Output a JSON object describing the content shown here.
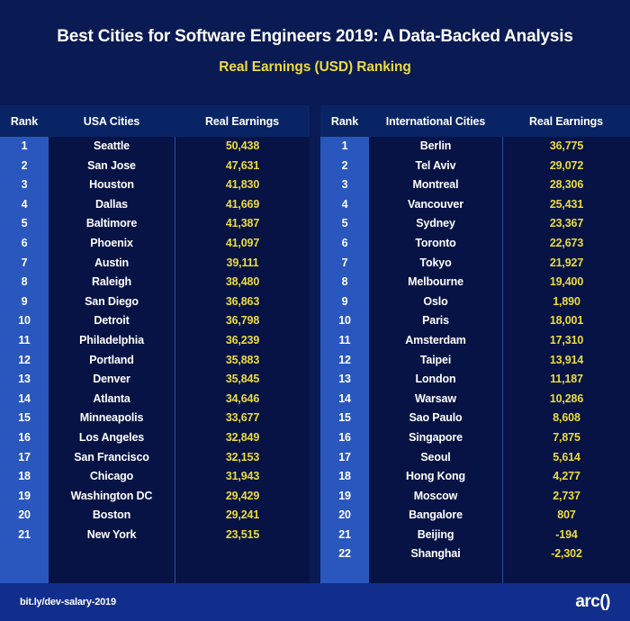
{
  "header": {
    "title": "Best Cities for Software Engineers 2019: A Data-Backed Analysis",
    "subtitle": "Real Earnings (USD) Ranking"
  },
  "colors": {
    "page_bg": "#0a1a52",
    "table_header_bg": "#082464",
    "table_body_bg": "#061344",
    "rank_col_bg": "#2a57bd",
    "accent_yellow": "#ecdc3e",
    "footer_bg": "#112e8c",
    "divider": "#2c4da3"
  },
  "footer": {
    "link": "bit.ly/dev-salary-2019",
    "logo": "arc()"
  },
  "chart_data": {
    "type": "table",
    "title": "Best Cities for Software Engineers 2019: A Data-Backed Analysis",
    "subtitle": "Real Earnings (USD) Ranking",
    "tables": [
      {
        "name": "usa",
        "columns": [
          "Rank",
          "USA Cities",
          "Real Earnings"
        ],
        "rows": [
          [
            1,
            "Seattle",
            "50,438"
          ],
          [
            2,
            "San Jose",
            "47,631"
          ],
          [
            3,
            "Houston",
            "41,830"
          ],
          [
            4,
            "Dallas",
            "41,669"
          ],
          [
            5,
            "Baltimore",
            "41,387"
          ],
          [
            6,
            "Phoenix",
            "41,097"
          ],
          [
            7,
            "Austin",
            "39,111"
          ],
          [
            8,
            "Raleigh",
            "38,480"
          ],
          [
            9,
            "San Diego",
            "36,863"
          ],
          [
            10,
            "Detroit",
            "36,798"
          ],
          [
            11,
            "Philadelphia",
            "36,239"
          ],
          [
            12,
            "Portland",
            "35,883"
          ],
          [
            13,
            "Denver",
            "35,845"
          ],
          [
            14,
            "Atlanta",
            "34,646"
          ],
          [
            15,
            "Minneapolis",
            "33,677"
          ],
          [
            16,
            "Los Angeles",
            "32,849"
          ],
          [
            17,
            "San Francisco",
            "32,153"
          ],
          [
            18,
            "Chicago",
            "31,943"
          ],
          [
            19,
            "Washington DC",
            "29,429"
          ],
          [
            20,
            "Boston",
            "29,241"
          ],
          [
            21,
            "New York",
            "23,515"
          ]
        ]
      },
      {
        "name": "international",
        "columns": [
          "Rank",
          "International Cities",
          "Real Earnings"
        ],
        "rows": [
          [
            1,
            "Berlin",
            "36,775"
          ],
          [
            2,
            "Tel Aviv",
            "29,072"
          ],
          [
            3,
            "Montreal",
            "28,306"
          ],
          [
            4,
            "Vancouver",
            "25,431"
          ],
          [
            5,
            "Sydney",
            "23,367"
          ],
          [
            6,
            "Toronto",
            "22,673"
          ],
          [
            7,
            "Tokyo",
            "21,927"
          ],
          [
            8,
            "Melbourne",
            "19,400"
          ],
          [
            9,
            "Oslo",
            "1,890"
          ],
          [
            10,
            "Paris",
            "18,001"
          ],
          [
            11,
            "Amsterdam",
            "17,310"
          ],
          [
            12,
            "Taipei",
            "13,914"
          ],
          [
            13,
            "London",
            "11,187"
          ],
          [
            14,
            "Warsaw",
            "10,286"
          ],
          [
            15,
            "Sao Paulo",
            "8,608"
          ],
          [
            16,
            "Singapore",
            "7,875"
          ],
          [
            17,
            "Seoul",
            "5,614"
          ],
          [
            18,
            "Hong Kong",
            "4,277"
          ],
          [
            19,
            "Moscow",
            "2,737"
          ],
          [
            20,
            "Bangalore",
            "807"
          ],
          [
            21,
            "Beijing",
            "-194"
          ],
          [
            22,
            "Shanghai",
            "-2,302"
          ]
        ]
      }
    ]
  }
}
